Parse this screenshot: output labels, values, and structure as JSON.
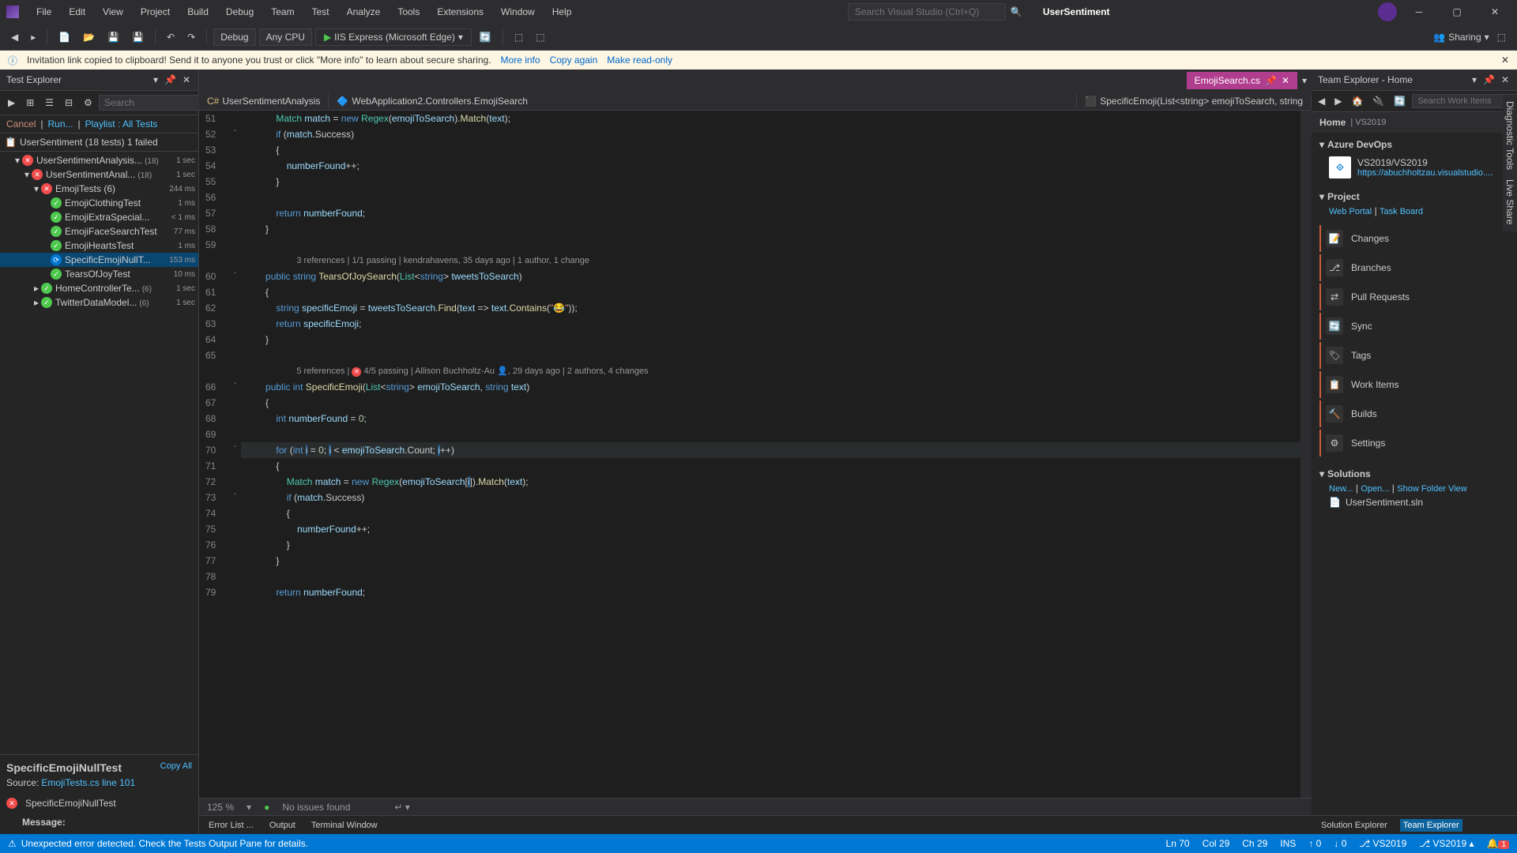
{
  "menus": [
    "File",
    "Edit",
    "View",
    "Project",
    "Build",
    "Debug",
    "Team",
    "Test",
    "Analyze",
    "Tools",
    "Extensions",
    "Window",
    "Help"
  ],
  "globalSearch": "Search Visual Studio (Ctrl+Q)",
  "solutionName": "UserSentiment",
  "toolbar": {
    "config": "Debug",
    "platform": "Any CPU",
    "runTarget": "IIS Express (Microsoft Edge)",
    "sharing": "Sharing"
  },
  "infoBar": {
    "message": "Invitation link copied to clipboard! Send it to anyone you trust or click \"More info\" to learn about secure sharing.",
    "moreInfo": "More info",
    "copyAgain": "Copy again",
    "readOnly": "Make read-only"
  },
  "testExplorer": {
    "title": "Test Explorer",
    "searchPlaceholder": "Search",
    "actions": {
      "cancel": "Cancel",
      "run": "Run...",
      "playlist": "Playlist : All Tests"
    },
    "root": {
      "name": "UserSentiment (18 tests) 1 failed"
    },
    "tree": [
      {
        "indent": 1,
        "chev": "▾",
        "icon": "fail",
        "name": "UserSentimentAnalysis...",
        "count": "(18)",
        "time": "1 sec"
      },
      {
        "indent": 2,
        "chev": "▾",
        "icon": "fail",
        "name": "UserSentimentAnal...",
        "count": "(18)",
        "time": "1 sec"
      },
      {
        "indent": 3,
        "chev": "▾",
        "icon": "fail",
        "name": "EmojiTests (6)",
        "time": "244 ms"
      },
      {
        "indent": 4,
        "icon": "pass",
        "name": "EmojiClothingTest",
        "time": "1 ms"
      },
      {
        "indent": 4,
        "icon": "pass",
        "name": "EmojiExtraSpecial...",
        "time": "< 1 ms"
      },
      {
        "indent": 4,
        "icon": "pass",
        "name": "EmojiFaceSearchTest",
        "time": "77 ms"
      },
      {
        "indent": 4,
        "icon": "pass",
        "name": "EmojiHeartsTest",
        "time": "1 ms"
      },
      {
        "indent": 4,
        "icon": "running",
        "name": "SpecificEmojiNullT...",
        "time": "153 ms",
        "selected": true
      },
      {
        "indent": 4,
        "icon": "pass",
        "name": "TearsOfJoyTest",
        "time": "10 ms"
      },
      {
        "indent": 3,
        "chev": "▸",
        "icon": "pass",
        "name": "HomeControllerTe...",
        "count": "(6)",
        "time": "1 sec"
      },
      {
        "indent": 3,
        "chev": "▸",
        "icon": "pass",
        "name": "TwitterDataModel...",
        "count": "(6)",
        "time": "1 sec"
      }
    ],
    "detail": {
      "title": "SpecificEmojiNullTest",
      "copyAll": "Copy All",
      "sourceLabel": "Source:",
      "sourceLink": "EmojiTests.cs line 101",
      "failName": "SpecificEmojiNullTest",
      "messageLabel": "Message:"
    }
  },
  "editor": {
    "tab": "EmojiSearch.cs",
    "breadcrumb": [
      "UserSentimentAnalysis",
      "WebApplication2.Controllers.EmojiSearch",
      "SpecificEmoji(List<string> emojiToSearch, string"
    ],
    "startLine": 51,
    "codelens1": "3 references | 1/1 passing | kendrahavens, 35 days ago | 1 author, 1 change",
    "codelens2a": "5 references | ",
    "codelens2b": " 4/5 passing | Allison Buchholtz-Au ",
    "codelens2c": ", 29 days ago | 2 authors, 4 changes",
    "status": {
      "zoom": "125 %",
      "issues": "No issues found"
    }
  },
  "teamExplorer": {
    "title": "Team Explorer - Home",
    "searchPlaceholder": "Search Work Items",
    "home": "Home",
    "homeSub": "| VS2019",
    "sections": {
      "azure": "Azure DevOps",
      "azureProject": "VS2019/VS2019",
      "azureUrl": "https://abuchholtzau.visualstudio....",
      "project": "Project",
      "webPortal": "Web Portal",
      "taskBoard": "Task Board",
      "solutions": "Solutions",
      "new": "New...",
      "open": "Open...",
      "showFolder": "Show Folder View",
      "slnFile": "UserSentiment.sln"
    },
    "tiles": [
      "Changes",
      "Branches",
      "Pull Requests",
      "Sync",
      "Tags",
      "Work Items",
      "Builds",
      "Settings"
    ]
  },
  "bottomTabs": {
    "left": [
      "Error List ...",
      "Output",
      "Terminal Window"
    ],
    "right": [
      "Solution Explorer",
      "Team Explorer"
    ]
  },
  "statusBar": {
    "error": "Unexpected error detected. Check the Tests Output Pane for details.",
    "ln": "Ln 70",
    "col": "Col 29",
    "ch": "Ch 29",
    "ins": "INS",
    "up": "0",
    "down": "0",
    "repo1": "VS2019",
    "repo2": "VS2019",
    "notif": "1"
  },
  "sideTabs": [
    "Diagnostic Tools",
    "Live Share"
  ]
}
